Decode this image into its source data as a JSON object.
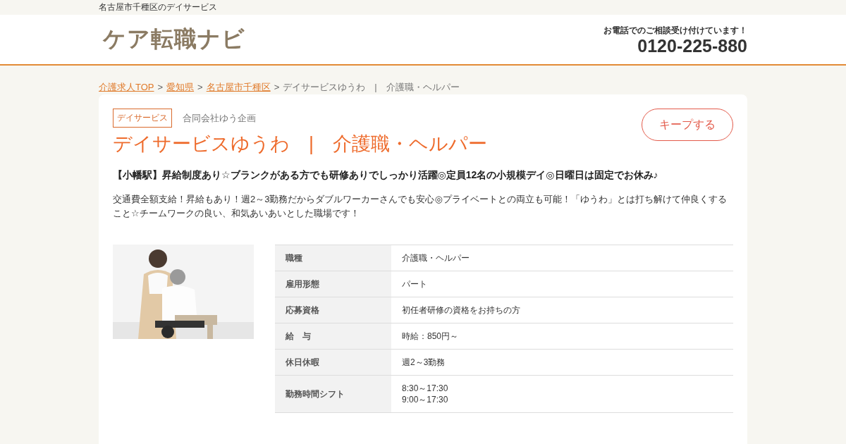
{
  "top_bar": {
    "text": "名古屋市千種区のデイサービス"
  },
  "header": {
    "logo": "ケア転職ナビ",
    "phone_note": "お電話でのご相談受け付けています！",
    "phone": "0120-225-880"
  },
  "breadcrumb": [
    {
      "label": "介護求人TOP",
      "link": true
    },
    {
      "label": "愛知県",
      "link": true
    },
    {
      "label": "名古屋市千種区",
      "link": true
    },
    {
      "label": "デイサービスゆうわ　|　介護職・ヘルパー",
      "link": false
    }
  ],
  "separator": ">",
  "job": {
    "tag": "デイサービス",
    "company": "合同会社ゆう企画",
    "keep_button": "キープする",
    "title": "デイサービスゆうわ　|　介護職・ヘルパー",
    "headline": "【小幡駅】昇給制度あり☆ブランクがある方でも研修ありでしっかり活躍◎定員12名の小規模デイ◎日曜日は固定でお休み♪",
    "description": "交通費全額支給！昇給もあり！週2～3勤務だからダブルワーカーさんでも安心◎プライベートとの両立も可能！「ゆうわ」とは打ち解けて仲良くすること☆チームワークの良い、和気あいあいとした職場です！",
    "details": [
      {
        "label": "職種",
        "values": [
          "介護職・ヘルパー"
        ]
      },
      {
        "label": "雇用形態",
        "values": [
          "パート"
        ]
      },
      {
        "label": "応募資格",
        "values": [
          "初任者研修の資格をお持ちの方"
        ]
      },
      {
        "label": "給　与",
        "values": [
          "時給：850円～"
        ]
      },
      {
        "label": "休日休暇",
        "values": [
          "週2～3勤務"
        ]
      },
      {
        "label": "勤務時間シフト",
        "values": [
          "8:30～17:30",
          "9:00～17:30"
        ]
      }
    ]
  }
}
